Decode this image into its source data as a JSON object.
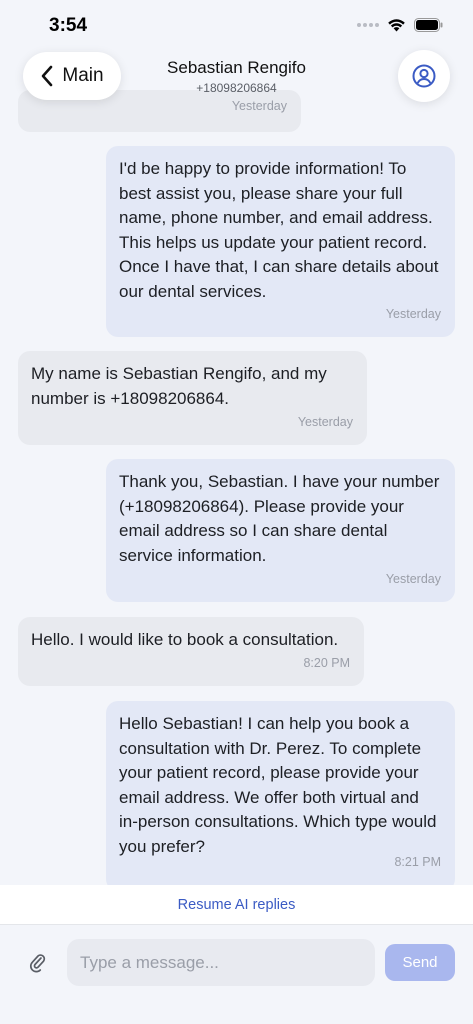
{
  "status_bar": {
    "time": "3:54"
  },
  "header": {
    "back_label": "Main",
    "contact_name": "Sebastian Rengifo",
    "contact_phone": "+18098206864"
  },
  "messages": [
    {
      "direction": "incoming",
      "text": "",
      "time": "Yesterday"
    },
    {
      "direction": "outgoing",
      "text": "I'd be happy to provide information! To best assist you, please share your full name, phone number, and email address. This helps us update your patient record. Once I have that, I can share details about our dental services.",
      "time": "Yesterday"
    },
    {
      "direction": "incoming",
      "text": "My name is Sebastian Rengifo, and my number is +18098206864.",
      "time": "Yesterday"
    },
    {
      "direction": "outgoing",
      "text": "Thank you, Sebastian. I have your number (+18098206864). Please provide your email address so I can share dental service information.",
      "time": "Yesterday"
    },
    {
      "direction": "incoming",
      "text": "Hello. I would like to book a consultation.",
      "time": "8:20 PM"
    },
    {
      "direction": "outgoing",
      "text": "Hello Sebastian! I can help you book a consultation with Dr. Perez. To complete your patient record, please provide your email address. We offer both virtual and in-person consultations. Which type would you prefer?",
      "time": "8:21 PM"
    }
  ],
  "resume_ai_label": "Resume AI replies",
  "composer": {
    "placeholder": "Type a message...",
    "send_label": "Send"
  },
  "colors": {
    "accent": "#3b5bc4",
    "outgoing_bubble": "#e3e8f6",
    "incoming_bubble": "#e8eaef",
    "send_button": "#a9b7ee"
  },
  "icons": {
    "back": "chevron-left-icon",
    "profile": "user-circle-icon",
    "attach": "paperclip-icon",
    "wifi": "wifi-icon",
    "battery": "battery-icon"
  }
}
